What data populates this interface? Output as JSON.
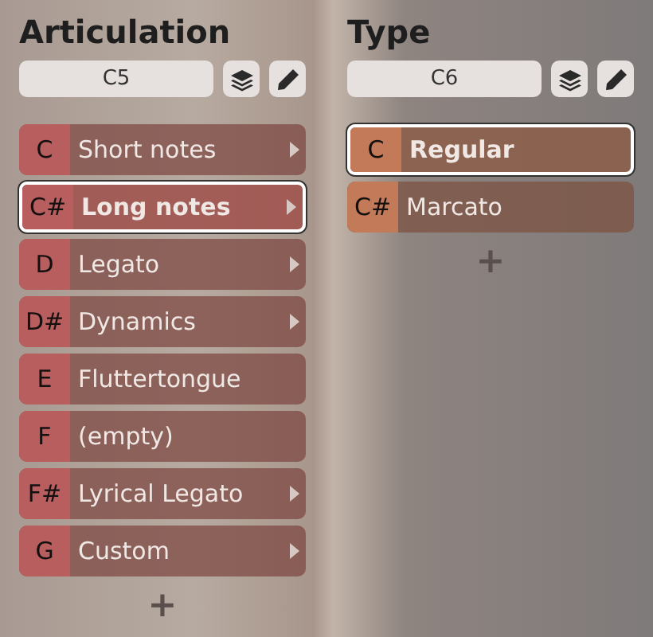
{
  "columns": [
    {
      "title": "Articulation",
      "field": {
        "value": "C5"
      },
      "color": "#b85e5e",
      "add_label": "+",
      "items": [
        {
          "key": "C",
          "label": "Short notes",
          "selected": false,
          "submenu": true
        },
        {
          "key": "C#",
          "label": "Long notes",
          "selected": true,
          "submenu": true
        },
        {
          "key": "D",
          "label": "Legato",
          "selected": false,
          "submenu": true
        },
        {
          "key": "D#",
          "label": "Dynamics",
          "selected": false,
          "submenu": true
        },
        {
          "key": "E",
          "label": "Fluttertongue",
          "selected": false,
          "submenu": false
        },
        {
          "key": "F",
          "label": "(empty)",
          "selected": false,
          "submenu": false
        },
        {
          "key": "F#",
          "label": "Lyrical Legato",
          "selected": false,
          "submenu": true
        },
        {
          "key": "G",
          "label": "Custom",
          "selected": false,
          "submenu": true
        }
      ]
    },
    {
      "title": "Type",
      "field": {
        "value": "C6"
      },
      "color": "#c27a58",
      "add_label": "+",
      "items": [
        {
          "key": "C",
          "label": "Regular",
          "selected": true,
          "submenu": false
        },
        {
          "key": "C#",
          "label": "Marcato",
          "selected": false,
          "submenu": false
        }
      ]
    }
  ]
}
